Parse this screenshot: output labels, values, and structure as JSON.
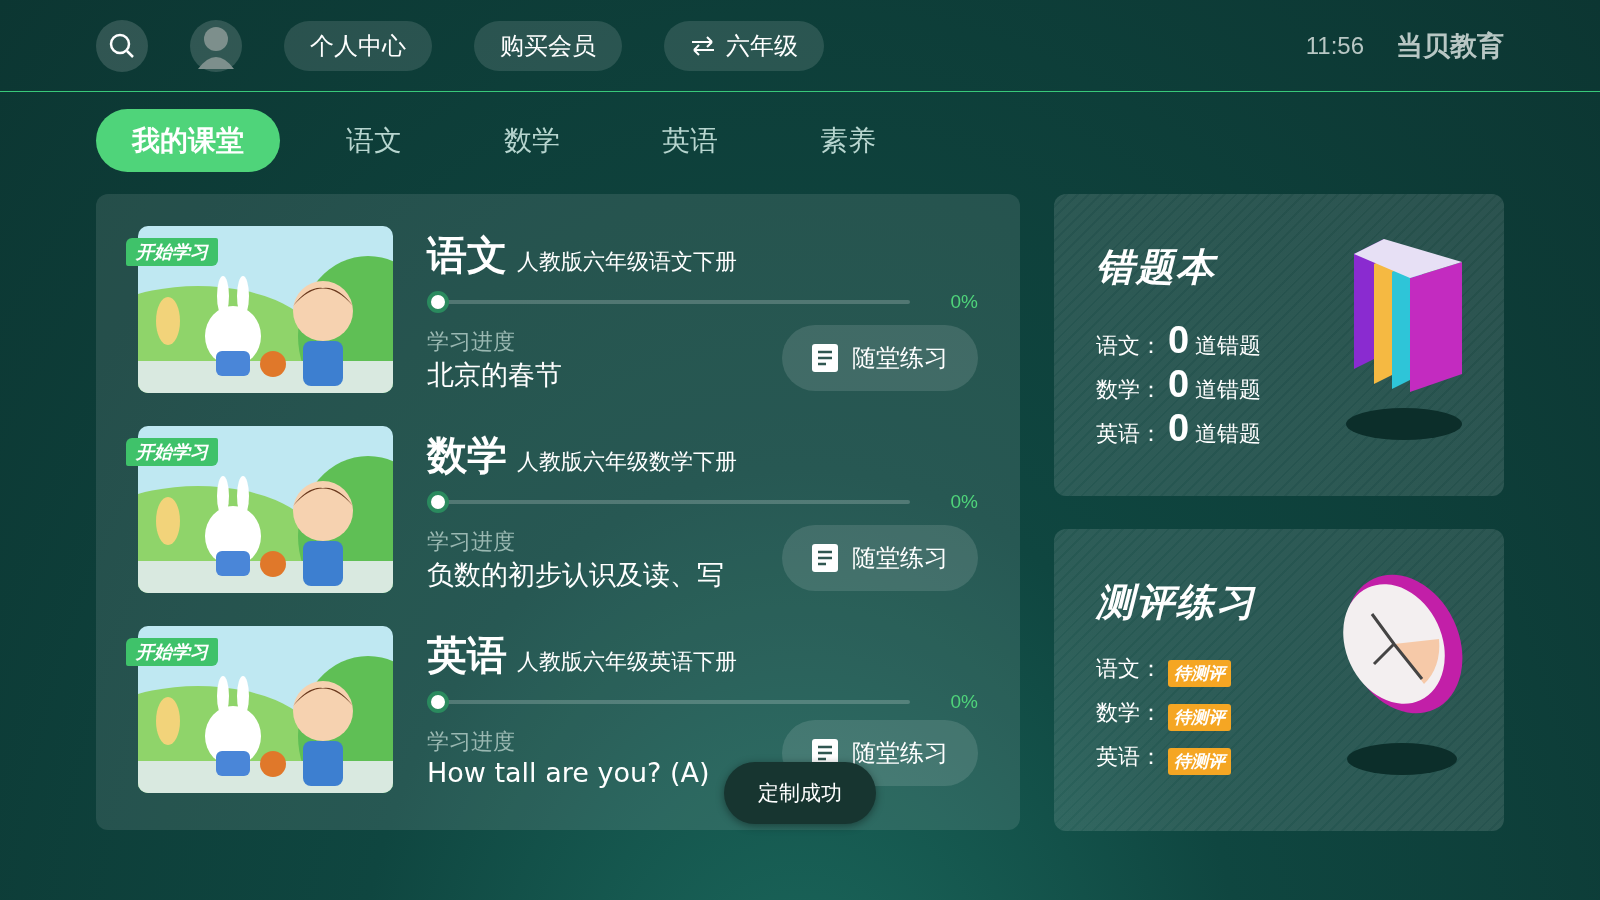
{
  "header": {
    "buttons": [
      {
        "label": "个人中心",
        "kind": "plain"
      },
      {
        "label": "购买会员",
        "kind": "plain"
      },
      {
        "label": "六年级",
        "kind": "switch"
      }
    ],
    "time": "11:56",
    "brand": "当贝教育"
  },
  "tabs": [
    {
      "label": "我的课堂",
      "selected": true
    },
    {
      "label": "语文",
      "selected": false
    },
    {
      "label": "数学",
      "selected": false
    },
    {
      "label": "英语",
      "selected": false
    },
    {
      "label": "素养",
      "selected": false
    }
  ],
  "courses": [
    {
      "badge": "开始学习",
      "subject": "语文",
      "book": "人教版六年级语文下册",
      "level": 0,
      "percent": "0%",
      "progress_label": "学习进度",
      "lesson": "北京的春节",
      "practice": "随堂练习"
    },
    {
      "badge": "开始学习",
      "subject": "数学",
      "book": "人教版六年级数学下册",
      "level": 0,
      "percent": "0%",
      "progress_label": "学习进度",
      "lesson": "负数的初步认识及读、写",
      "practice": "随堂练习"
    },
    {
      "badge": "开始学习",
      "subject": "英语",
      "book": "人教版六年级英语下册",
      "level": 0,
      "percent": "0%",
      "progress_label": "学习进度",
      "lesson": "How tall are you? (A)",
      "practice": "随堂练习"
    }
  ],
  "mistakes": {
    "title": "错题本",
    "rows": [
      {
        "subject": "语文：",
        "count": "0",
        "unit": "道错题"
      },
      {
        "subject": "数学：",
        "count": "0",
        "unit": "道错题"
      },
      {
        "subject": "英语：",
        "count": "0",
        "unit": "道错题"
      }
    ]
  },
  "assessment": {
    "title": "测评练习",
    "rows": [
      {
        "subject": "语文：",
        "status": "待测评"
      },
      {
        "subject": "数学：",
        "status": "待测评"
      },
      {
        "subject": "英语：",
        "status": "待测评"
      }
    ]
  },
  "toast": "定制成功"
}
